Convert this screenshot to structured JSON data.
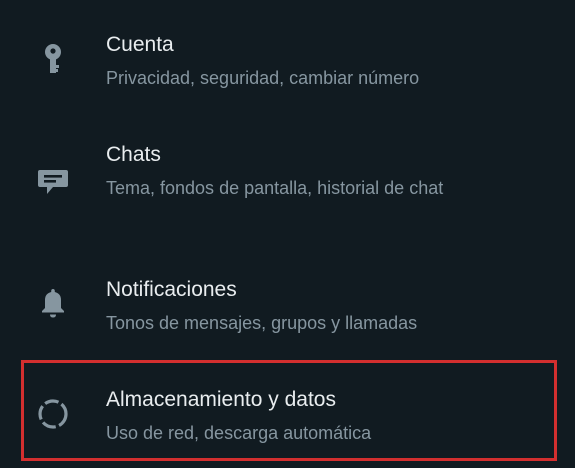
{
  "settings": {
    "items": [
      {
        "icon": "key-icon",
        "title": "Cuenta",
        "subtitle": "Privacidad, seguridad, cambiar número"
      },
      {
        "icon": "chat-icon",
        "title": "Chats",
        "subtitle": "Tema, fondos de pantalla, historial de chat"
      },
      {
        "icon": "bell-icon",
        "title": "Notificaciones",
        "subtitle": "Tonos de mensajes, grupos y llamadas"
      },
      {
        "icon": "storage-circle-icon",
        "title": "Almacenamiento y datos",
        "subtitle": "Uso de red, descarga automática"
      }
    ]
  },
  "colors": {
    "background": "#111b21",
    "title_text": "#e9edef",
    "subtitle_text": "#8696a0",
    "icon": "#8696a0",
    "highlight_border": "#d32f2f"
  }
}
